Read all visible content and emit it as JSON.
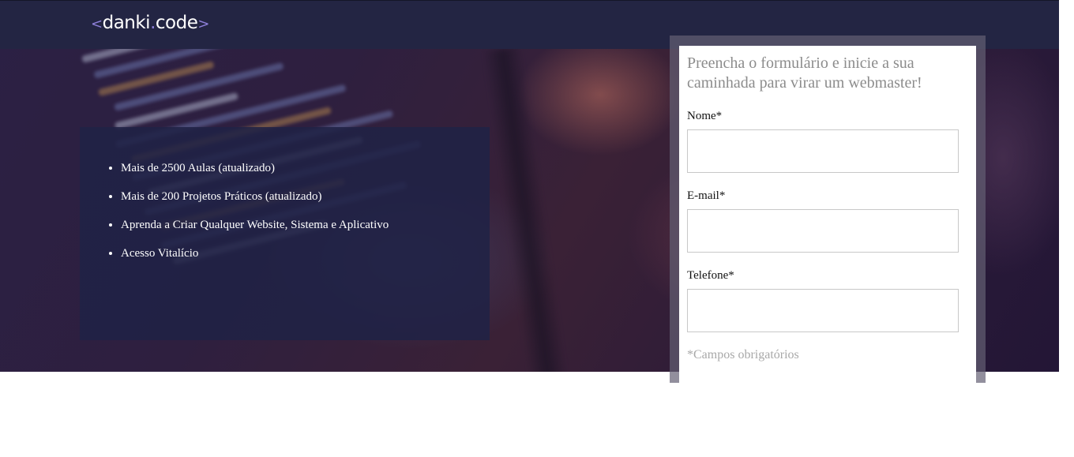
{
  "brand": {
    "logo_prefix": "<",
    "logo_part1": "danki",
    "logo_dot": ".",
    "logo_part2": "code",
    "logo_suffix": ">"
  },
  "features": {
    "items": [
      "Mais de 2500 Aulas (atualizado)",
      "Mais de 200 Projetos Práticos (atualizado)",
      "Aprenda a Criar Qualquer Website, Sistema e Aplicativo",
      "Acesso Vitalício"
    ]
  },
  "form": {
    "title": "Preencha o formulário e inicie a sua caminhada para virar um webmaster!",
    "fields": [
      {
        "label": "Nome*",
        "value": ""
      },
      {
        "label": "E-mail*",
        "value": ""
      },
      {
        "label": "Telefone*",
        "value": ""
      }
    ],
    "required_note": "*Campos obrigatórios"
  },
  "colors": {
    "header_bg": "#232543",
    "accent": "#8d7fd8",
    "features_bg": "#202246"
  }
}
